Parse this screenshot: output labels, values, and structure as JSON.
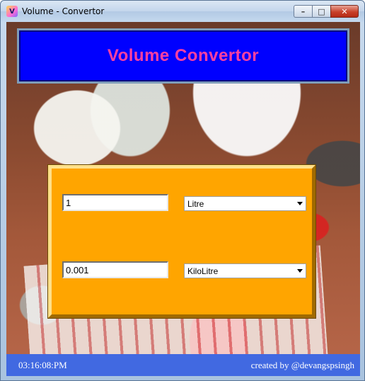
{
  "window": {
    "title": "Volume - Convertor",
    "icon": "app-icon",
    "controls": {
      "minimize": "minimize-icon",
      "maximize": "maximize-icon",
      "close": "close-icon"
    }
  },
  "header": {
    "title": "Volume Convertor"
  },
  "converter": {
    "input_value": "1",
    "input_unit": "Litre",
    "output_value": "0.001",
    "output_unit": "KiloLitre"
  },
  "status": {
    "time": "03:16:08:PM",
    "credit": "created by @devangspsingh"
  },
  "colors": {
    "header_bg": "#0000ff",
    "header_text": "#ff40a0",
    "panel_bg": "#ffa500",
    "status_bg": "#4169e1"
  }
}
